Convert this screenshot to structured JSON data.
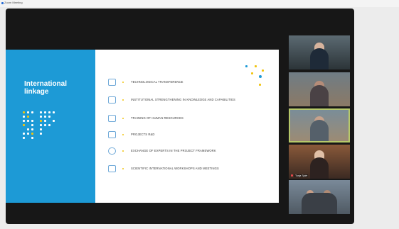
{
  "window": {
    "title": "Zoom Meeting"
  },
  "slide": {
    "title": "International linkage",
    "items": [
      {
        "label": "TECHNOLOGICAL TRANSFERENCE",
        "icon": "network-icon"
      },
      {
        "label": "INSTITUTIONAL STRENGTHENING IN KNOWLEDGE AND CAPABILITIES",
        "icon": "building-icon"
      },
      {
        "label": "TRAINING OF HUMAN RESOURCES",
        "icon": "presentation-icon"
      },
      {
        "label": "PROJECTS R&D",
        "icon": "chart-icon"
      },
      {
        "label": "EXCHANGE OF EXPERTS IN THE PROJECT FRAMEWORK",
        "icon": "globe-icon"
      },
      {
        "label": "SCIENTIFIC INTERNATIONAL WORKSHOPS AND MEETINGS",
        "icon": "monitor-icon"
      }
    ],
    "colors": {
      "accent_blue": "#1d9ad6",
      "accent_yellow": "#f1c40f"
    }
  },
  "participants": [
    {
      "name": "",
      "active": false
    },
    {
      "name": "",
      "active": false
    },
    {
      "name": "",
      "active": true
    },
    {
      "name": "Tanja Splet",
      "active": false
    },
    {
      "name": "",
      "active": false
    }
  ]
}
